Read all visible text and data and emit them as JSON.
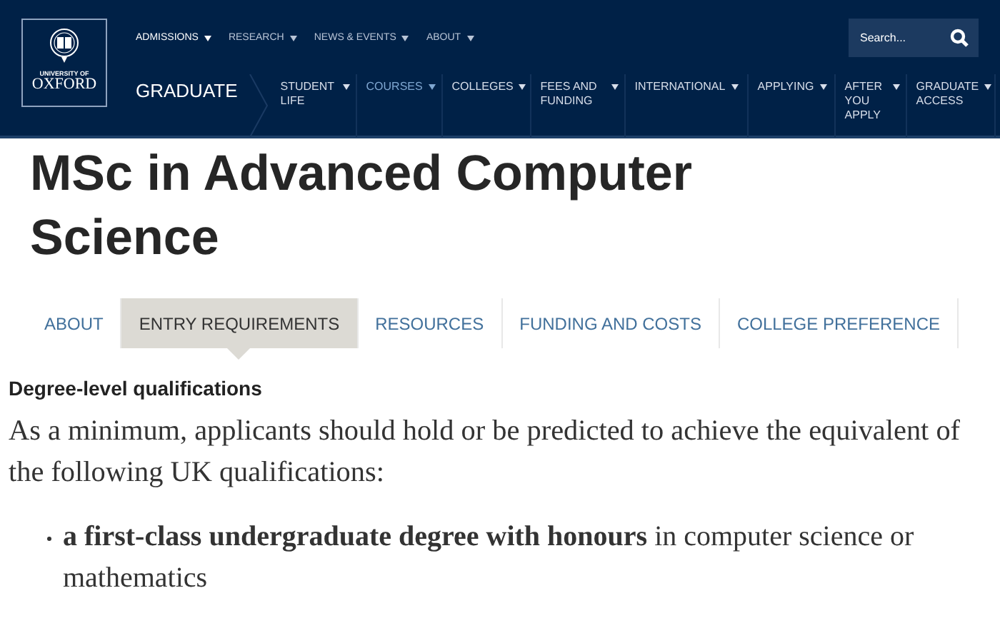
{
  "logo": {
    "line_1": "UNIVERSITY OF",
    "line_2": "OXFORD"
  },
  "top_links": [
    {
      "label": "ADMISSIONS",
      "dropdown": true,
      "selected": true
    },
    {
      "label": "RESEARCH",
      "dropdown": true,
      "selected": false
    },
    {
      "label": "NEWS & EVENTS",
      "dropdown": true,
      "selected": false
    },
    {
      "label": "ABOUT",
      "dropdown": true,
      "selected": false
    }
  ],
  "search": {
    "placeholder": "Search..."
  },
  "section": "GRADUATE",
  "main_nav": [
    {
      "label": "STUDENT LIFE",
      "dropdown": true,
      "selected": false
    },
    {
      "label": "COURSES",
      "dropdown": true,
      "selected": true
    },
    {
      "label": "COLLEGES",
      "dropdown": true,
      "selected": false
    },
    {
      "label": "FEES AND FUNDING",
      "dropdown": true,
      "selected": false
    },
    {
      "label": "INTERNATIONAL",
      "dropdown": true,
      "selected": false
    },
    {
      "label": "APPLYING",
      "dropdown": true,
      "selected": false
    },
    {
      "label": "AFTER YOU APPLY",
      "dropdown": true,
      "selected": false
    },
    {
      "label": "GRADUATE ACCESS",
      "dropdown": true,
      "selected": false
    }
  ],
  "title": "MSc in Advanced Computer Science",
  "tabs": [
    {
      "label": "ABOUT",
      "selected": false
    },
    {
      "label": "ENTRY REQUIREMENTS",
      "selected": true
    },
    {
      "label": "RESOURCES",
      "selected": false
    },
    {
      "label": "FUNDING AND COSTS",
      "selected": false
    },
    {
      "label": "COLLEGE PREFERENCE",
      "selected": false
    }
  ],
  "heading": "Degree-level qualifications",
  "intro": "As a minimum, applicants should hold or be predicted to achieve the equivalent of the following UK qualifications:",
  "bullets": [
    "**a first-class undergraduate degree with honours** in computer science or mathematics"
  ]
}
